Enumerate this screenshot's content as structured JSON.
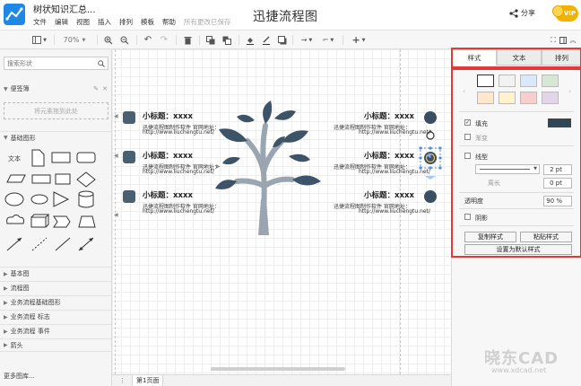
{
  "header": {
    "doc_title": "树状知识汇总...",
    "app_title": "迅捷流程图",
    "menu": [
      "文件",
      "编辑",
      "视图",
      "插入",
      "排列",
      "模板",
      "帮助"
    ],
    "save_status": "所有更改已保存",
    "share_label": "分享",
    "vip_label": "VIP"
  },
  "toolbar": {
    "zoom": "70%"
  },
  "sidebar": {
    "search_placeholder": "搜索形状",
    "scratchpad_title": "便签簿",
    "scratchpad_drop": "将元素拖到此处",
    "basic_shapes_title": "基础图形",
    "basic_text_shape": "文本",
    "categories": [
      "基本图",
      "流程图",
      "业务流程基础图形",
      "业务流程 标志",
      "业务流程 事件",
      "箭头"
    ],
    "more_shapes": "更多图库..."
  },
  "canvas": {
    "nodes": [
      {
        "title": "小标题：xxxx",
        "line1": "迅捷流程图制作软件 官网地址：",
        "line2": "http://www.liuchengtu.net/"
      },
      {
        "title": "小标题：xxxx",
        "line1": "迅捷流程图制作软件 官网地址：",
        "line2": "http://www.liuchengtu.net/"
      },
      {
        "title": "小标题：xxxx",
        "line1": "迅捷流程图制作软件 官网地址：",
        "line2": "http://www.liuchengtu.net/"
      },
      {
        "title": "小标题：xxxx",
        "line1": "迅捷流程图制作软件 官网地址：",
        "line2": "http://www.liuchengtu.net/"
      },
      {
        "title": "小标题：xxxx",
        "line1": "迅捷流程图制作软件 官网地址：",
        "line2": "http://www.liuchengtu.net/"
      },
      {
        "title": "小标题：xxxx",
        "line1": "迅捷流程图制作软件 官网地址：",
        "line2": "http://www.liuchengtu.net/"
      }
    ],
    "tree_color": "#3d5468",
    "trunk_color": "#9aa5b1"
  },
  "bottombar": {
    "page_tab": "第1页面"
  },
  "panel": {
    "tabs": [
      "样式",
      "文本",
      "排列"
    ],
    "style_swatches": [
      "#ffffff",
      "#f2f2f2",
      "#dae8fc",
      "#d5e8d4",
      "#ffe6cc",
      "#fff2cc",
      "#f8cecc",
      "#e1d5e7"
    ],
    "fill_label": "填充",
    "fill_color": "#2f4858",
    "gradient_label": "渐变",
    "line_label": "线型",
    "line_width": "2 pt",
    "perimeter_label": "周长",
    "perimeter_value": "0 pt",
    "opacity_label": "透明度",
    "opacity_value": "90 %",
    "shadow_label": "阴影",
    "copy_style": "复制样式",
    "paste_style": "粘贴样式",
    "set_default": "设置为默认样式"
  },
  "watermark": {
    "brand": "晓东CAD",
    "url": "www.xdcad.net"
  }
}
